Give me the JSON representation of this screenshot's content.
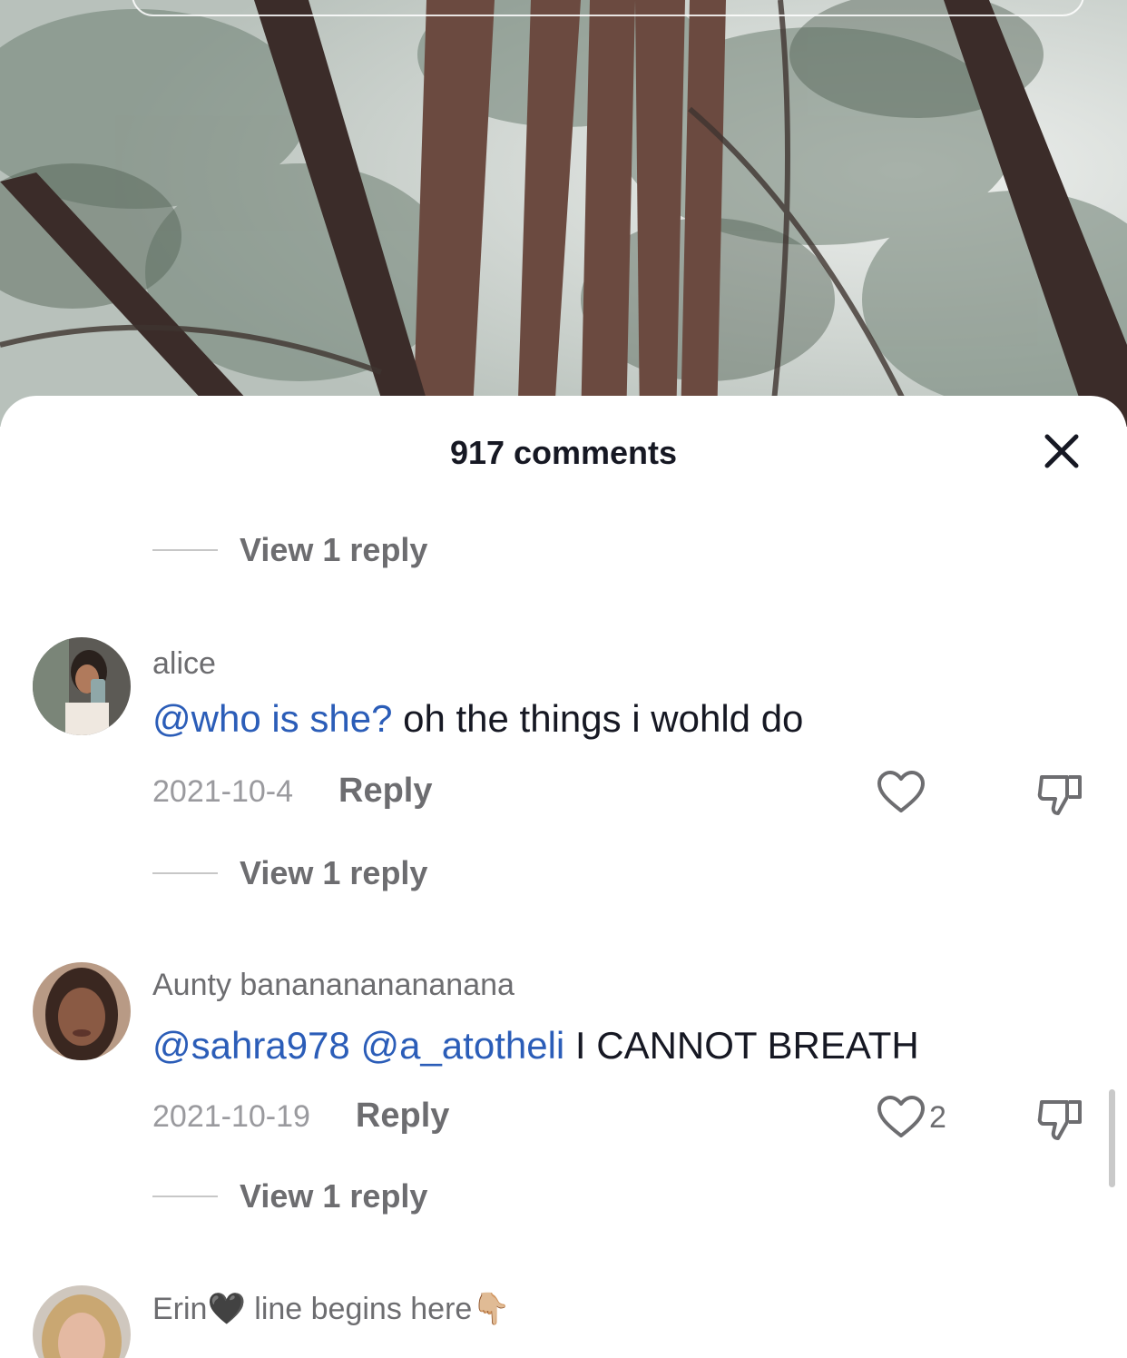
{
  "header": {
    "title": "917 comments"
  },
  "icons": {
    "close": "close-icon",
    "like": "heart-icon",
    "dislike": "thumbs-down-icon"
  },
  "colors": {
    "mention": "#2b5db8",
    "text": "#161823",
    "muted": "#6d6d70"
  },
  "view_replies": [
    "View 1 reply",
    "View 1 reply",
    "View 1 reply"
  ],
  "comments": [
    {
      "username": "alice",
      "mentions": [
        "@who is she?"
      ],
      "text": "oh the things i wohld do",
      "date": "2021-10-4",
      "reply_label": "Reply",
      "likes": ""
    },
    {
      "username": "Aunty bananananananana",
      "mentions": [
        "@sahra978",
        "@a_atotheli"
      ],
      "text": "I CANNOT BREATH",
      "date": "2021-10-19",
      "reply_label": "Reply",
      "likes": "2"
    },
    {
      "username": "Erin",
      "username_suffix": "line begins here",
      "username_emoji": [
        "🖤",
        "👇🏼"
      ]
    }
  ]
}
